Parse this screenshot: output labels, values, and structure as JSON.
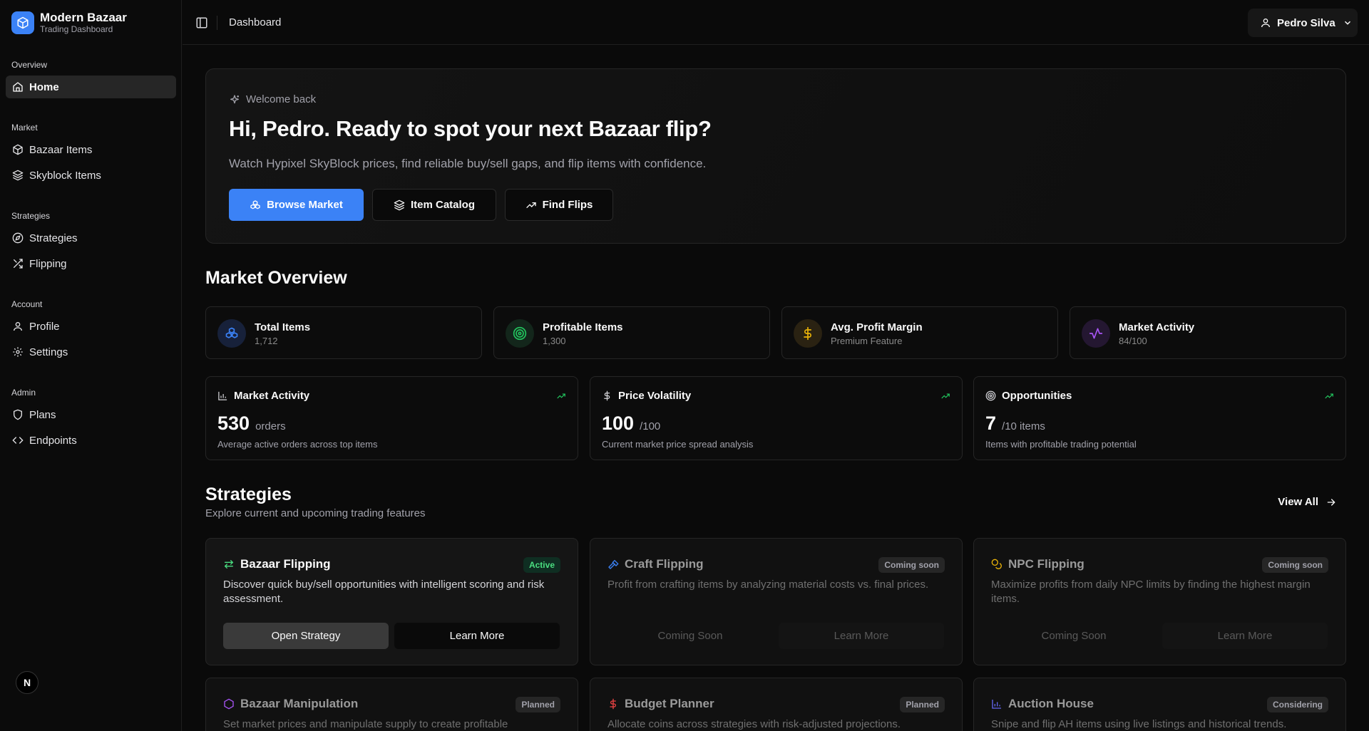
{
  "brand": {
    "name": "Modern Bazaar",
    "subtitle": "Trading Dashboard"
  },
  "sidebar": {
    "groups": [
      {
        "label": "Overview",
        "items": [
          {
            "label": "Home",
            "icon": "home-icon",
            "active": true
          }
        ]
      },
      {
        "label": "Market",
        "items": [
          {
            "label": "Bazaar Items",
            "icon": "box-icon"
          },
          {
            "label": "Skyblock Items",
            "icon": "layers-icon"
          }
        ]
      },
      {
        "label": "Strategies",
        "items": [
          {
            "label": "Strategies",
            "icon": "compass-icon"
          },
          {
            "label": "Flipping",
            "icon": "shuffle-icon"
          }
        ]
      },
      {
        "label": "Account",
        "items": [
          {
            "label": "Profile",
            "icon": "user-icon"
          },
          {
            "label": "Settings",
            "icon": "gear-icon"
          }
        ]
      },
      {
        "label": "Admin",
        "items": [
          {
            "label": "Plans",
            "icon": "shield-icon"
          },
          {
            "label": "Endpoints",
            "icon": "code-icon"
          }
        ]
      }
    ],
    "badge": "N"
  },
  "topbar": {
    "breadcrumb": "Dashboard",
    "user_name": "Pedro Silva"
  },
  "hero": {
    "kicker": "Welcome back",
    "title": "Hi, Pedro. Ready to spot your next Bazaar flip?",
    "subtitle": "Watch Hypixel SkyBlock prices, find reliable buy/sell gaps, and flip items with confidence.",
    "buttons": [
      {
        "label": "Browse Market"
      },
      {
        "label": "Item Catalog"
      },
      {
        "label": "Find Flips"
      }
    ]
  },
  "market_overview": {
    "title": "Market Overview",
    "stats": [
      {
        "label": "Total Items",
        "value": "1,712",
        "color": "#3b82f6",
        "icon": "cubes-icon"
      },
      {
        "label": "Profitable Items",
        "value": "1,300",
        "color": "#22c55e",
        "icon": "target-icon"
      },
      {
        "label": "Avg. Profit Margin",
        "value": "Premium Feature",
        "color": "#eab308",
        "icon": "dollar-icon"
      },
      {
        "label": "Market Activity",
        "value": "84/100",
        "color": "#a855f7",
        "icon": "activity-icon"
      }
    ],
    "metrics": [
      {
        "title": "Market Activity",
        "number": "530",
        "unit": "orders",
        "desc": "Average active orders across top items"
      },
      {
        "title": "Price Volatility",
        "number": "100",
        "unit": "/100",
        "desc": "Current market price spread analysis"
      },
      {
        "title": "Opportunities",
        "number": "7",
        "unit": "/10 items",
        "desc": "Items with profitable trading potential"
      }
    ]
  },
  "strategies": {
    "title": "Strategies",
    "subtitle": "Explore current and upcoming trading features",
    "view_all": "View All",
    "cards": [
      {
        "title": "Bazaar Flipping",
        "badge": "Active",
        "desc": "Discover quick buy/sell opportunities with intelligent scoring and risk assessment.",
        "primary": "Open Strategy",
        "secondary": "Learn More"
      },
      {
        "title": "Craft Flipping",
        "badge": "Coming soon",
        "desc": "Profit from crafting items by analyzing material costs vs. final prices.",
        "primary": "Coming Soon",
        "secondary": "Learn More"
      },
      {
        "title": "NPC Flipping",
        "badge": "Coming soon",
        "desc": "Maximize profits from daily NPC limits by finding the highest margin items.",
        "primary": "Coming Soon",
        "secondary": "Learn More"
      },
      {
        "title": "Bazaar Manipulation",
        "badge": "Planned",
        "desc": "Set market prices and manipulate supply to create profitable"
      },
      {
        "title": "Budget Planner",
        "badge": "Planned",
        "desc": "Allocate coins across strategies with risk-adjusted projections."
      },
      {
        "title": "Auction House",
        "badge": "Considering",
        "desc": "Snipe and flip AH items using live listings and historical trends."
      }
    ]
  }
}
